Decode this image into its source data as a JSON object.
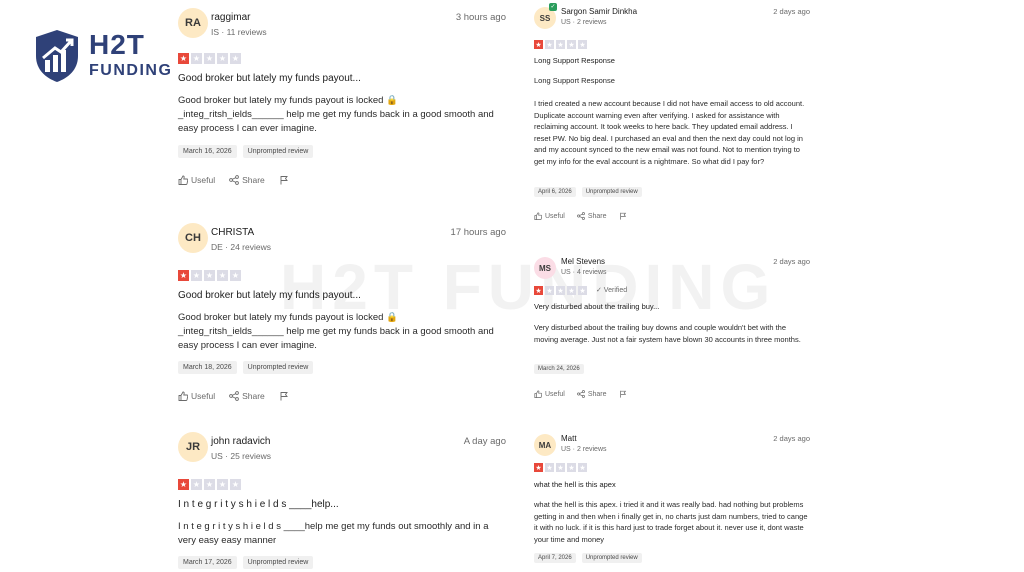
{
  "logo": {
    "brand": "H2T",
    "sub": "FUNDING"
  },
  "watermark": "H2T FUNDING",
  "actions": {
    "useful": "Useful",
    "share": "Share"
  },
  "left_reviews": [
    {
      "initials": "RA",
      "name": "raggimar",
      "meta": "IS · 11 reviews",
      "time": "3 hours ago",
      "rating": 1,
      "title": "Good broker but lately my funds payout...",
      "body": "Good broker but lately my funds payout is locked 🔒 _integ_ritsh_ields______ help me get my funds back in a good smooth and easy process I can ever imagine.",
      "date": "March 16, 2026",
      "tag": "Unprompted review"
    },
    {
      "initials": "CH",
      "name": "CHRISTA",
      "meta": "DE · 24 reviews",
      "time": "17 hours ago",
      "rating": 1,
      "title": "Good broker but lately my funds payout...",
      "body": "Good broker but lately my funds payout is locked 🔒 _integ_ritsh_ields______ help me get my funds back in a good smooth and easy process I can ever imagine.",
      "date": "March 18, 2026",
      "tag": "Unprompted review"
    },
    {
      "initials": "JR",
      "name": "john radavich",
      "meta": "US · 25 reviews",
      "time": "A day ago",
      "rating": 1,
      "title": "I n t e g r i t y s h i e l d s ____help...",
      "body": "I n t e g r i t y s h i e l d s ____help me get my funds out smoothly and in a very easy easy manner",
      "date": "March 17, 2026",
      "tag": "Unprompted review"
    }
  ],
  "right_reviews": [
    {
      "initials": "SS",
      "name": "Sargon Samir Dinkha",
      "meta": "US · 2 reviews",
      "time": "2 days ago",
      "rating": 1,
      "title": "Long Support Response",
      "body": "Long Support Response",
      "body2": "I tried created a new account because I did not have email access to old account. Duplicate account warning even after verifying. I asked for assistance with reclaiming account. It took weeks to here back. They updated email address. I reset PW. No big deal. I purchased an eval and then the next day could not log in and my account synced to the new email was not found. Not to mention trying to get my info for the eval account is a nightmare. So what did I pay for?",
      "date": "April 6, 2026",
      "tag": "Unprompted review"
    },
    {
      "initials": "MS",
      "name": "Mel Stevens",
      "meta": "US · 4 reviews",
      "time": "2 days ago",
      "rating": 1,
      "verified": "✓ Verified",
      "title": "Very disturbed about the trailing buy...",
      "body": "Very disturbed about the trailing buy downs and couple wouldn't bet with the moving average. Just not a fair system have blown 30 accounts in three months.",
      "date": "March 24, 2026"
    },
    {
      "initials": "MA",
      "name": "Matt",
      "meta": "US · 2 reviews",
      "time": "2 days ago",
      "rating": 1,
      "title": "what the hell is this apex",
      "body": "what the hell is this apex. i tried it and it was really bad. had nothing but problems getting in and then when i finally get in, no charts just dam numbers, tried to cange it with no luck. if it is this hard just to trade forget about it. never use it, dont waste your time and money",
      "date": "April 7, 2026",
      "tag": "Unprompted review"
    }
  ]
}
